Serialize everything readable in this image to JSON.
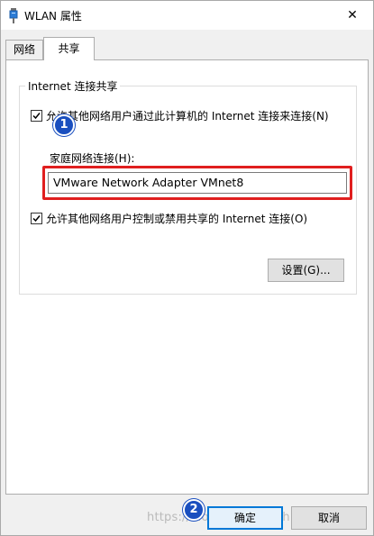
{
  "window": {
    "title": "WLAN 属性",
    "close_glyph": "✕"
  },
  "tabs": [
    {
      "label": "网络",
      "selected": false
    },
    {
      "label": "共享",
      "selected": true
    }
  ],
  "sharing": {
    "group_title": "Internet 连接共享",
    "allow_connect": {
      "label": "允许其他网络用户通过此计算机的 Internet 连接来连接(N)",
      "checked": true
    },
    "home_network_label": "家庭网络连接(H):",
    "home_network_value": "VMware Network Adapter VMnet8",
    "allow_control": {
      "label": "允许其他网络用户控制或禁用共享的 Internet 连接(O)",
      "checked": true
    },
    "settings_button": "设置(G)..."
  },
  "footer": {
    "ok_button": "确定",
    "cancel_button": "取消"
  },
  "annotations": {
    "step1": "1",
    "step2": "2",
    "highlight_color": "#e01f1f",
    "badge_color": "#1a4fbf"
  },
  "watermark": "https://blog.csdn.net/shichaosong1"
}
